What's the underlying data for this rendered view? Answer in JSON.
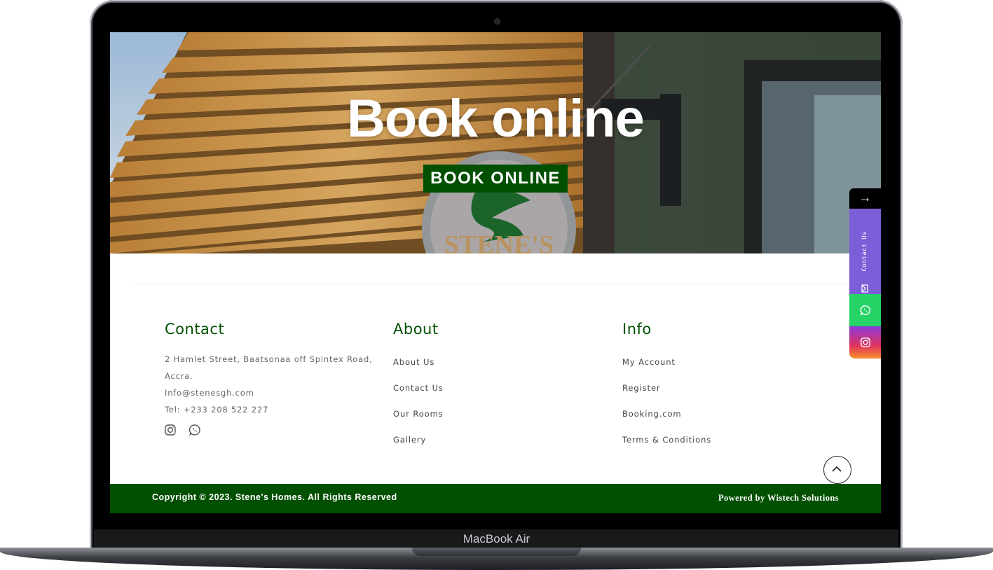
{
  "device": {
    "brand_label": "MacBook Air"
  },
  "hero": {
    "title": "Book online",
    "button_label": "BOOK ONLINE",
    "sign_text": "STENE'S"
  },
  "footer": {
    "contact": {
      "title": "Contact",
      "address_line1": "2 Hamlet Street, Baatsonaa off Spintex Road,",
      "address_line2": "Accra.",
      "email": "Info@stenesgh.com",
      "phone": "Tel: +233 208 522 227",
      "social_icons": [
        "instagram-icon",
        "whatsapp-icon"
      ]
    },
    "about": {
      "title": "About",
      "links": [
        "About Us",
        "Contact Us",
        "Our Rooms",
        "Gallery"
      ]
    },
    "info": {
      "title": "Info",
      "links": [
        "My Account",
        "Register",
        "Booking.com",
        "Terms & Conditions"
      ]
    }
  },
  "bottom_bar": {
    "copyright": "Copyright © 2023. Stene's Homes. All Rights Reserved",
    "powered_by": "Powered by Wistech Solutions"
  },
  "side_widget": {
    "toggle_label": "→",
    "contact_label": "Contact Us",
    "icons": [
      "mail-icon",
      "whatsapp-icon",
      "instagram-icon"
    ]
  },
  "colors": {
    "brand_green": "#005000",
    "contact_purple": "#7c5fd8",
    "whatsapp_green": "#25d366",
    "hero_wood": "#d9a454"
  }
}
